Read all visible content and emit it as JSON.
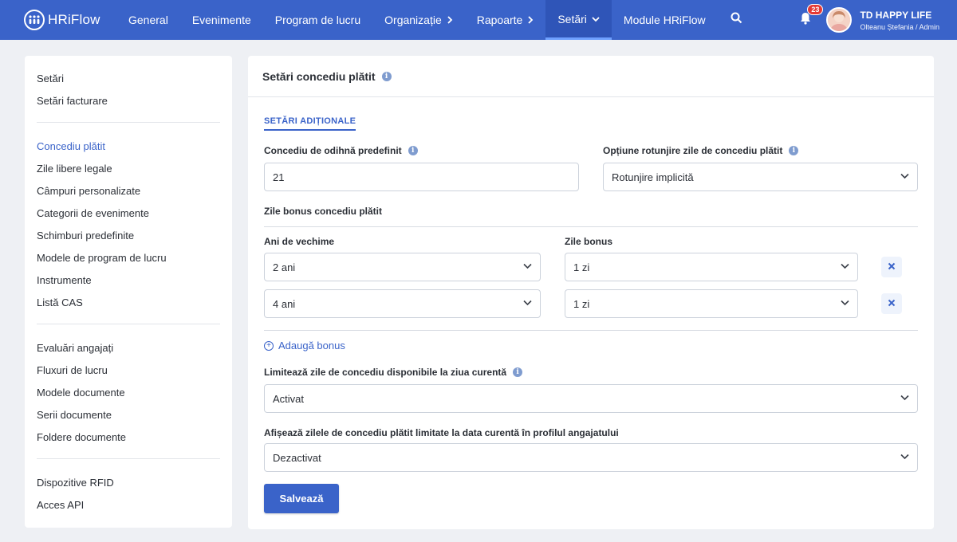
{
  "brand": {
    "name": "HRiFlow"
  },
  "nav": {
    "items": [
      {
        "label": "General"
      },
      {
        "label": "Evenimente"
      },
      {
        "label": "Program de lucru"
      },
      {
        "label": "Organizație"
      },
      {
        "label": "Rapoarte"
      },
      {
        "label": "Setări"
      },
      {
        "label": "Module HRiFlow"
      }
    ]
  },
  "user": {
    "notifications": "23",
    "company": "TD HAPPY LIFE",
    "name_role": "Olteanu Ștefania / Admin"
  },
  "sidebar": {
    "group1": [
      "Setări",
      "Setări facturare"
    ],
    "group2": [
      "Concediu plătit",
      "Zile libere legale",
      "Câmpuri personalizate",
      "Categorii de evenimente",
      "Schimburi predefinite",
      "Modele de program de lucru",
      "Instrumente",
      "Listă CAS"
    ],
    "group3": [
      "Evaluări angajați",
      "Fluxuri de lucru",
      "Modele documente",
      "Serii documente",
      "Foldere documente"
    ],
    "group4": [
      "Dispozitive RFID",
      "Acces API"
    ]
  },
  "page": {
    "title": "Setări concediu plătit",
    "section_tab": "SETĂRI ADIȚIONALE",
    "default_leave_label": "Concediu de odihnă predefinit",
    "default_leave_value": "21",
    "rounding_label": "Opțiune rotunjire zile de concediu plătit",
    "rounding_value": "Rotunjire implicită",
    "bonus_title": "Zile bonus concediu plătit",
    "seniority_header": "Ani de vechime",
    "bonus_header": "Zile bonus",
    "bonus_rows": [
      {
        "seniority": "2 ani",
        "bonus": "1 zi"
      },
      {
        "seniority": "4 ani",
        "bonus": "1 zi"
      }
    ],
    "add_bonus": "Adaugă bonus",
    "limit_label": "Limitează zile de concediu disponibile la ziua curentă",
    "limit_value": "Activat",
    "display_label": "Afișează zilele de concediu plătit limitate la data curentă în profilul angajatului",
    "display_value": "Dezactivat",
    "save": "Salvează"
  },
  "colors": {
    "primary": "#3a63c9",
    "background": "#eef0f4"
  }
}
